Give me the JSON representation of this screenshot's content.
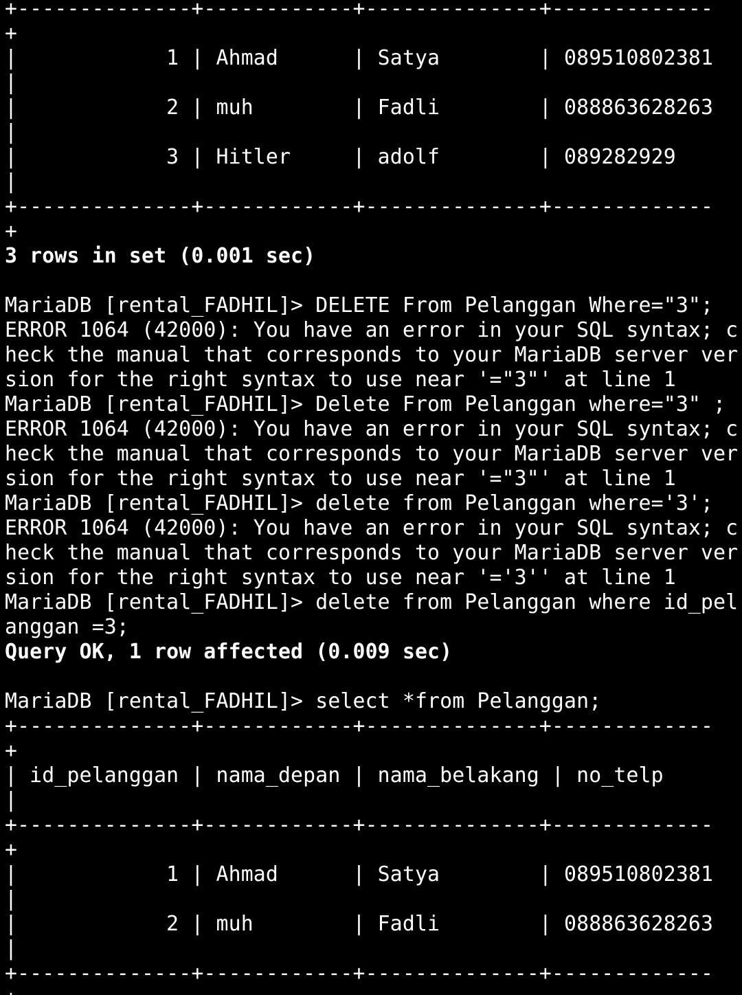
{
  "terminal": {
    "lines": [
      {
        "text": "+--------------+------------+--------------+-------------",
        "bold": false
      },
      {
        "text": "+",
        "bold": false
      },
      {
        "text": "|            1 | Ahmad      | Satya        | 089510802381",
        "bold": false
      },
      {
        "text": "|",
        "bold": false
      },
      {
        "text": "|            2 | muh        | Fadli        | 088863628263",
        "bold": false
      },
      {
        "text": "|",
        "bold": false
      },
      {
        "text": "|            3 | Hitler     | adolf        | 089282929",
        "bold": false
      },
      {
        "text": "|",
        "bold": false
      },
      {
        "text": "+--------------+------------+--------------+-------------",
        "bold": false
      },
      {
        "text": "+",
        "bold": false
      },
      {
        "text": "3 rows in set (0.001 sec)",
        "bold": true
      },
      {
        "text": "",
        "bold": false
      },
      {
        "text": "MariaDB [rental_FADHIL]> DELETE From Pelanggan Where=\"3\";",
        "bold": false
      },
      {
        "text": "ERROR 1064 (42000): You have an error in your SQL syntax; c",
        "bold": false
      },
      {
        "text": "heck the manual that corresponds to your MariaDB server ver",
        "bold": false
      },
      {
        "text": "sion for the right syntax to use near '=\"3\"' at line 1",
        "bold": false
      },
      {
        "text": "MariaDB [rental_FADHIL]> Delete From Pelanggan where=\"3\" ;",
        "bold": false
      },
      {
        "text": "ERROR 1064 (42000): You have an error in your SQL syntax; c",
        "bold": false
      },
      {
        "text": "heck the manual that corresponds to your MariaDB server ver",
        "bold": false
      },
      {
        "text": "sion for the right syntax to use near '=\"3\"' at line 1",
        "bold": false
      },
      {
        "text": "MariaDB [rental_FADHIL]> delete from Pelanggan where='3';",
        "bold": false
      },
      {
        "text": "ERROR 1064 (42000): You have an error in your SQL syntax; c",
        "bold": false
      },
      {
        "text": "heck the manual that corresponds to your MariaDB server ver",
        "bold": false
      },
      {
        "text": "sion for the right syntax to use near '='3'' at line 1",
        "bold": false
      },
      {
        "text": "MariaDB [rental_FADHIL]> delete from Pelanggan where id_pel",
        "bold": false
      },
      {
        "text": "anggan =3;",
        "bold": false
      },
      {
        "text": "Query OK, 1 row affected (0.009 sec)",
        "bold": true
      },
      {
        "text": "",
        "bold": false
      },
      {
        "text": "MariaDB [rental_FADHIL]> select *from Pelanggan;",
        "bold": false
      },
      {
        "text": "+--------------+------------+--------------+-------------",
        "bold": false
      },
      {
        "text": "+",
        "bold": false
      },
      {
        "text": "| id_pelanggan | nama_depan | nama_belakang | no_telp",
        "bold": false
      },
      {
        "text": "|",
        "bold": false
      },
      {
        "text": "+--------------+------------+--------------+-------------",
        "bold": false
      },
      {
        "text": "+",
        "bold": false
      },
      {
        "text": "|            1 | Ahmad      | Satya        | 089510802381",
        "bold": false
      },
      {
        "text": "|",
        "bold": false
      },
      {
        "text": "|            2 | muh        | Fadli        | 088863628263",
        "bold": false
      },
      {
        "text": "|",
        "bold": false
      },
      {
        "text": "+--------------+------------+--------------+-------------",
        "bold": false
      },
      {
        "text": "+",
        "bold": false
      }
    ]
  },
  "colors": {
    "background": "#000000",
    "foreground": "#ffffff"
  }
}
